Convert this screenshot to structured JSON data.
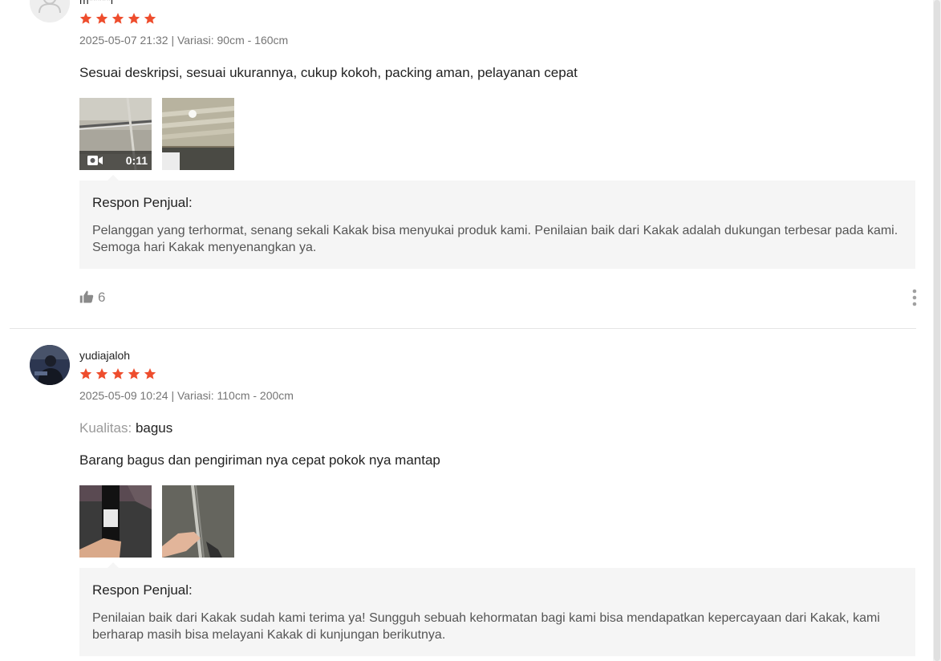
{
  "reviews": [
    {
      "username": "m*****l",
      "rating": 5,
      "date": "2025-05-07 21:32",
      "separator": "|",
      "variation": "Variasi: 90cm - 160cm",
      "comment": "Sesuai deskripsi, sesuai ukurannya, cukup kokoh, packing aman, pelayanan cepat",
      "video_duration": "0:11",
      "reply_title": "Respon Penjual:",
      "reply_text": "Pelanggan yang terhormat, senang sekali Kakak bisa menyukai produk kami. Penilaian baik dari Kakak adalah dukungan terbesar pada kami. Semoga hari Kakak menyenangkan ya.",
      "likes": "6"
    },
    {
      "username": "yudiajaloh",
      "rating": 5,
      "date": "2025-05-09 10:24",
      "separator": "|",
      "variation": "Variasi: 110cm - 200cm",
      "quality_label": "Kualitas:",
      "quality_value": "bagus",
      "comment": "Barang bagus dan pengiriman nya cepat pokok nya mantap",
      "reply_title": "Respon Penjual:",
      "reply_text": "Penilaian baik dari Kakak sudah kami terima ya! Sungguh sebuah kehormatan bagi kami bisa mendapatkan kepercayaan dari Kakak, kami berharap masih bisa melayani Kakak di kunjungan berikutnya."
    }
  ],
  "colors": {
    "star": "#ee4d2d",
    "reply_bg": "#f5f5f5",
    "meta_text": "#757575"
  },
  "icons": [
    "user-placeholder-icon",
    "star-icon",
    "video-camera-icon",
    "thumbs-up-icon",
    "more-vertical-icon"
  ]
}
